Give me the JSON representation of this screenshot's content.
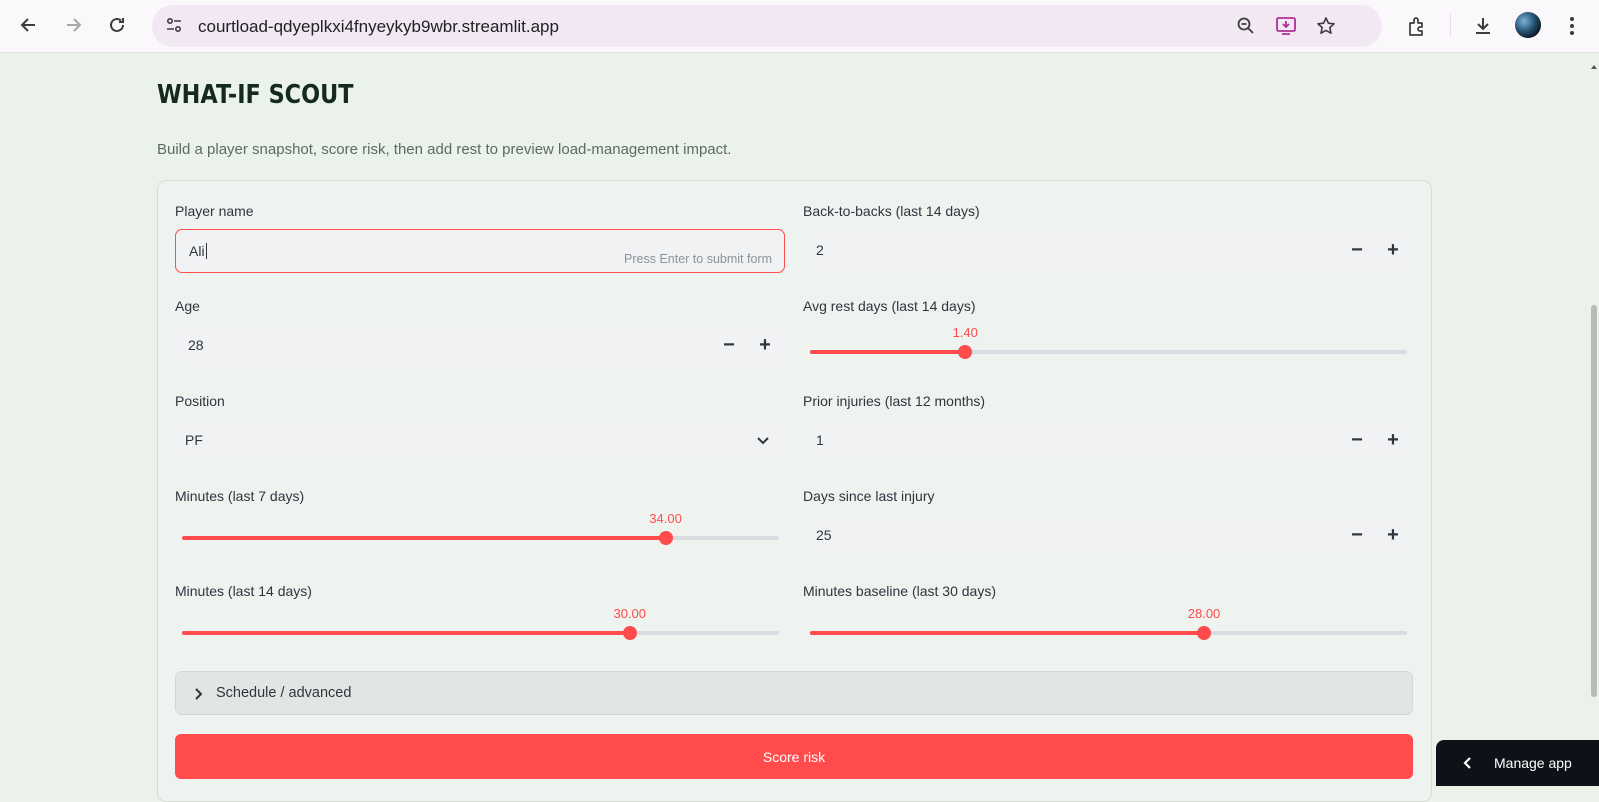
{
  "browser": {
    "url": "courtload-qdyeplkxi4fnyeykyb9wbr.streamlit.app"
  },
  "page": {
    "title": "WHAT-IF SCOUT",
    "subtitle": "Build a player snapshot, score risk, then add rest to preview load-management impact."
  },
  "form": {
    "player_name": {
      "label": "Player name",
      "value": "Ali",
      "hint": "Press Enter to submit form"
    },
    "age": {
      "label": "Age",
      "value": "28"
    },
    "position": {
      "label": "Position",
      "value": "PF"
    },
    "minutes_7": {
      "label": "Minutes (last 7 days)",
      "value": "34.00",
      "fraction": 0.81
    },
    "minutes_14": {
      "label": "Minutes (last 14 days)",
      "value": "30.00",
      "fraction": 0.75
    },
    "back_to_backs": {
      "label": "Back-to-backs (last 14 days)",
      "value": "2"
    },
    "avg_rest": {
      "label": "Avg rest days (last 14 days)",
      "value": "1.40",
      "fraction": 0.26
    },
    "prior_injuries": {
      "label": "Prior injuries (last 12 months)",
      "value": "1"
    },
    "days_since_injury": {
      "label": "Days since last injury",
      "value": "25"
    },
    "minutes_baseline": {
      "label": "Minutes baseline (last 30 days)",
      "value": "28.00",
      "fraction": 0.66
    },
    "stepper": {
      "minus": "−",
      "plus": "+"
    },
    "expander_label": "Schedule / advanced",
    "submit_label": "Score risk"
  },
  "manage_app": {
    "label": "Manage app"
  },
  "colors": {
    "accent": "#ff4b4b",
    "background": "#eaf2ea",
    "manage_bg": "#0e1117"
  }
}
